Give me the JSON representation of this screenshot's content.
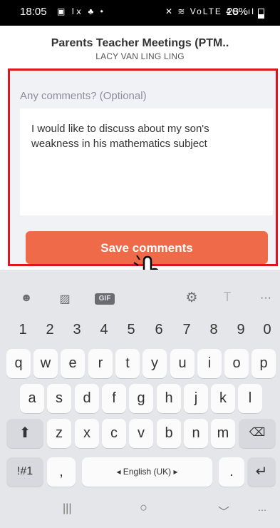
{
  "status_bar": {
    "time": "18:05",
    "left_icons": "▣ ⅼⅹ ♣ •",
    "right_icons": "✕ ≋ VoLTE 4G .ıl",
    "battery": "28%"
  },
  "header": {
    "title": "Parents Teacher Meetings (PTM..",
    "subtitle": "LACY VAN LING LING"
  },
  "comments": {
    "label": "Any comments? (Optional)",
    "value": "I would like to discuss about my son's weakness in his mathematics subject",
    "save_label": "Save comments"
  },
  "keyboard": {
    "toolbar": {
      "gif": "GIF",
      "more": "···",
      "emoji": "☻",
      "sticker": "▨",
      "settings": "⚙",
      "text_style": "T"
    },
    "row_numbers": [
      "1",
      "2",
      "3",
      "4",
      "5",
      "6",
      "7",
      "8",
      "9",
      "0"
    ],
    "row1": [
      "q",
      "w",
      "e",
      "r",
      "t",
      "y",
      "u",
      "i",
      "o",
      "p"
    ],
    "row2": [
      "a",
      "s",
      "d",
      "f",
      "g",
      "h",
      "j",
      "k",
      "l"
    ],
    "row3": [
      "z",
      "x",
      "c",
      "v",
      "b",
      "n",
      "m"
    ],
    "shift": "⬆",
    "backspace": "⌫",
    "symbols": "!#1",
    "comma": ",",
    "space": "◂ English (UK) ▸",
    "period": ".",
    "enter": "↵"
  },
  "nav_bar": {
    "recent": "|||",
    "home": "○",
    "back": "﹀",
    "keyboard": "⋯"
  },
  "colors": {
    "accent": "#ef6a48",
    "highlight_frame": "#e0141b",
    "label": "#8a8fa0"
  }
}
